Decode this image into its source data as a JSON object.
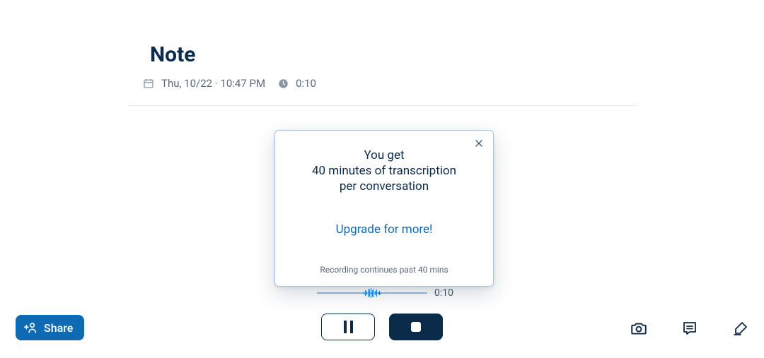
{
  "title": "Note",
  "meta": {
    "datetime": "Thu, 10/22 · 10:47 PM",
    "duration": "0:10"
  },
  "popover": {
    "line1": "You get",
    "line2": "40 minutes of transcription",
    "line3": "per conversation",
    "upgrade": "Upgrade for more!",
    "subtext": "Recording continues past 40 mins"
  },
  "wave": {
    "time": "0:10"
  },
  "share": {
    "label": "Share"
  }
}
